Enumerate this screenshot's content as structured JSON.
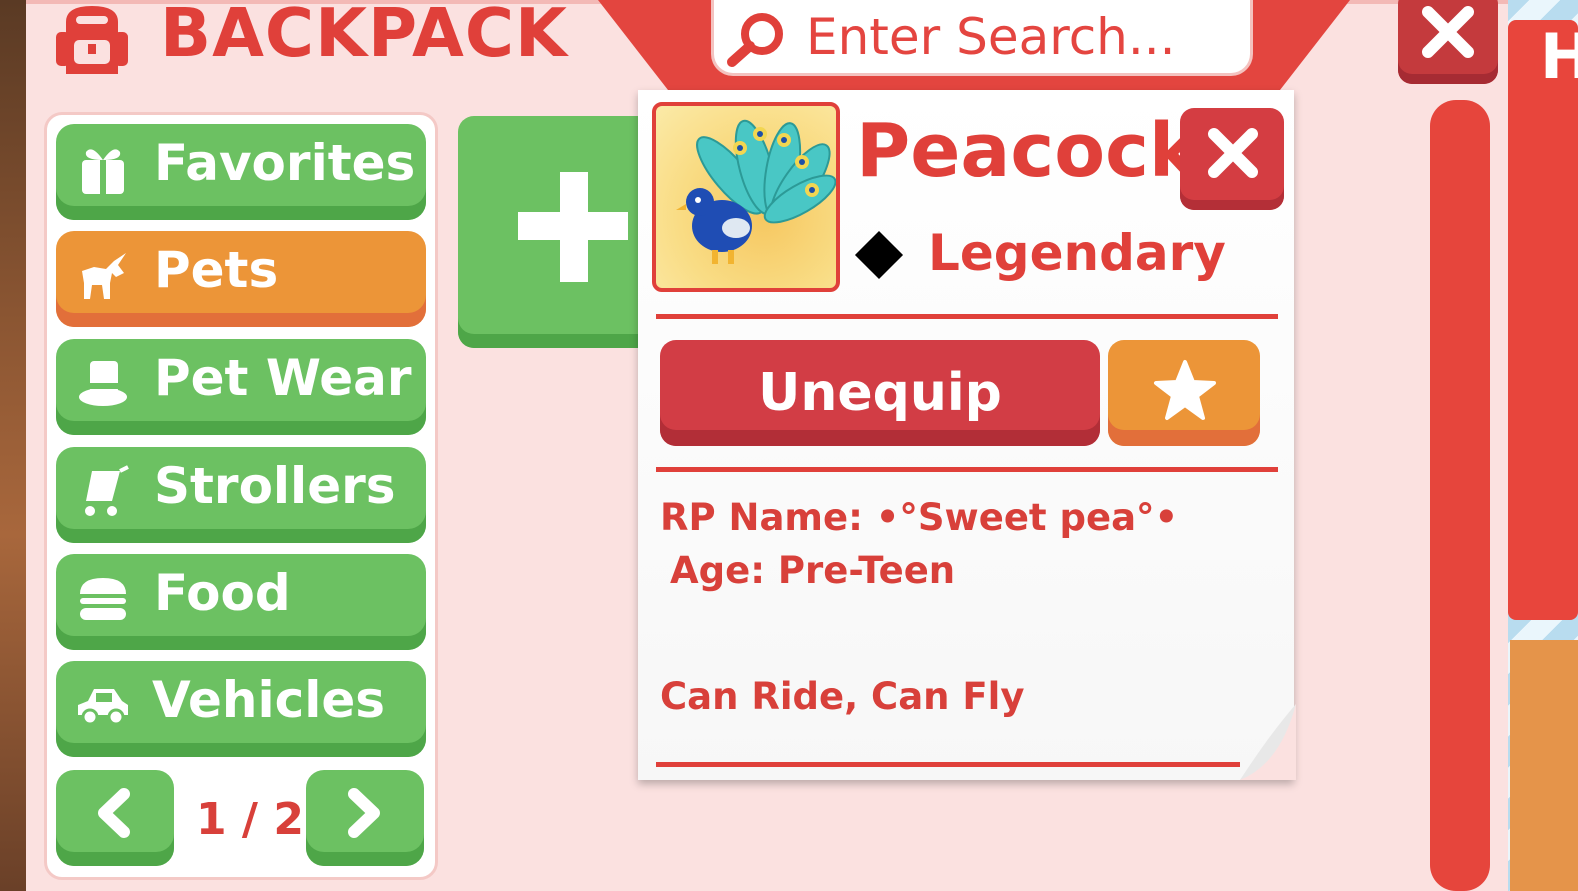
{
  "header": {
    "title": "BACKPACK",
    "icon": "backpack-icon"
  },
  "search": {
    "placeholder": "Enter Search...",
    "icon": "search-icon"
  },
  "sidebar": {
    "categories": [
      {
        "label": "Favorites",
        "icon": "gift-icon",
        "active": false
      },
      {
        "label": "Pets",
        "icon": "unicorn-icon",
        "active": true
      },
      {
        "label": "Pet Wear",
        "icon": "top-hat-icon",
        "active": false
      },
      {
        "label": "Strollers",
        "icon": "stroller-icon",
        "active": false
      },
      {
        "label": "Food",
        "icon": "burger-icon",
        "active": false
      },
      {
        "label": "Vehicles",
        "icon": "car-icon",
        "active": false
      }
    ],
    "pagination": {
      "current": "1 / 2",
      "prev_icon": "chevron-left-icon",
      "next_icon": "chevron-right-icon"
    }
  },
  "detail": {
    "name": "Peacock",
    "rarity": "Legendary",
    "rarity_icon": "diamond-icon",
    "primary_action": "Unequip",
    "favorite_icon": "star-icon",
    "rp_name": "RP Name: •°Sweet pea°•",
    "age": "Age: Pre-Teen",
    "abilities": "Can Ride, Can Fly"
  },
  "colors": {
    "accent_red": "#e0403a",
    "green_button": "#6cc162",
    "orange_button": "#ec9538",
    "panel_bg": "#fbe1e0"
  }
}
